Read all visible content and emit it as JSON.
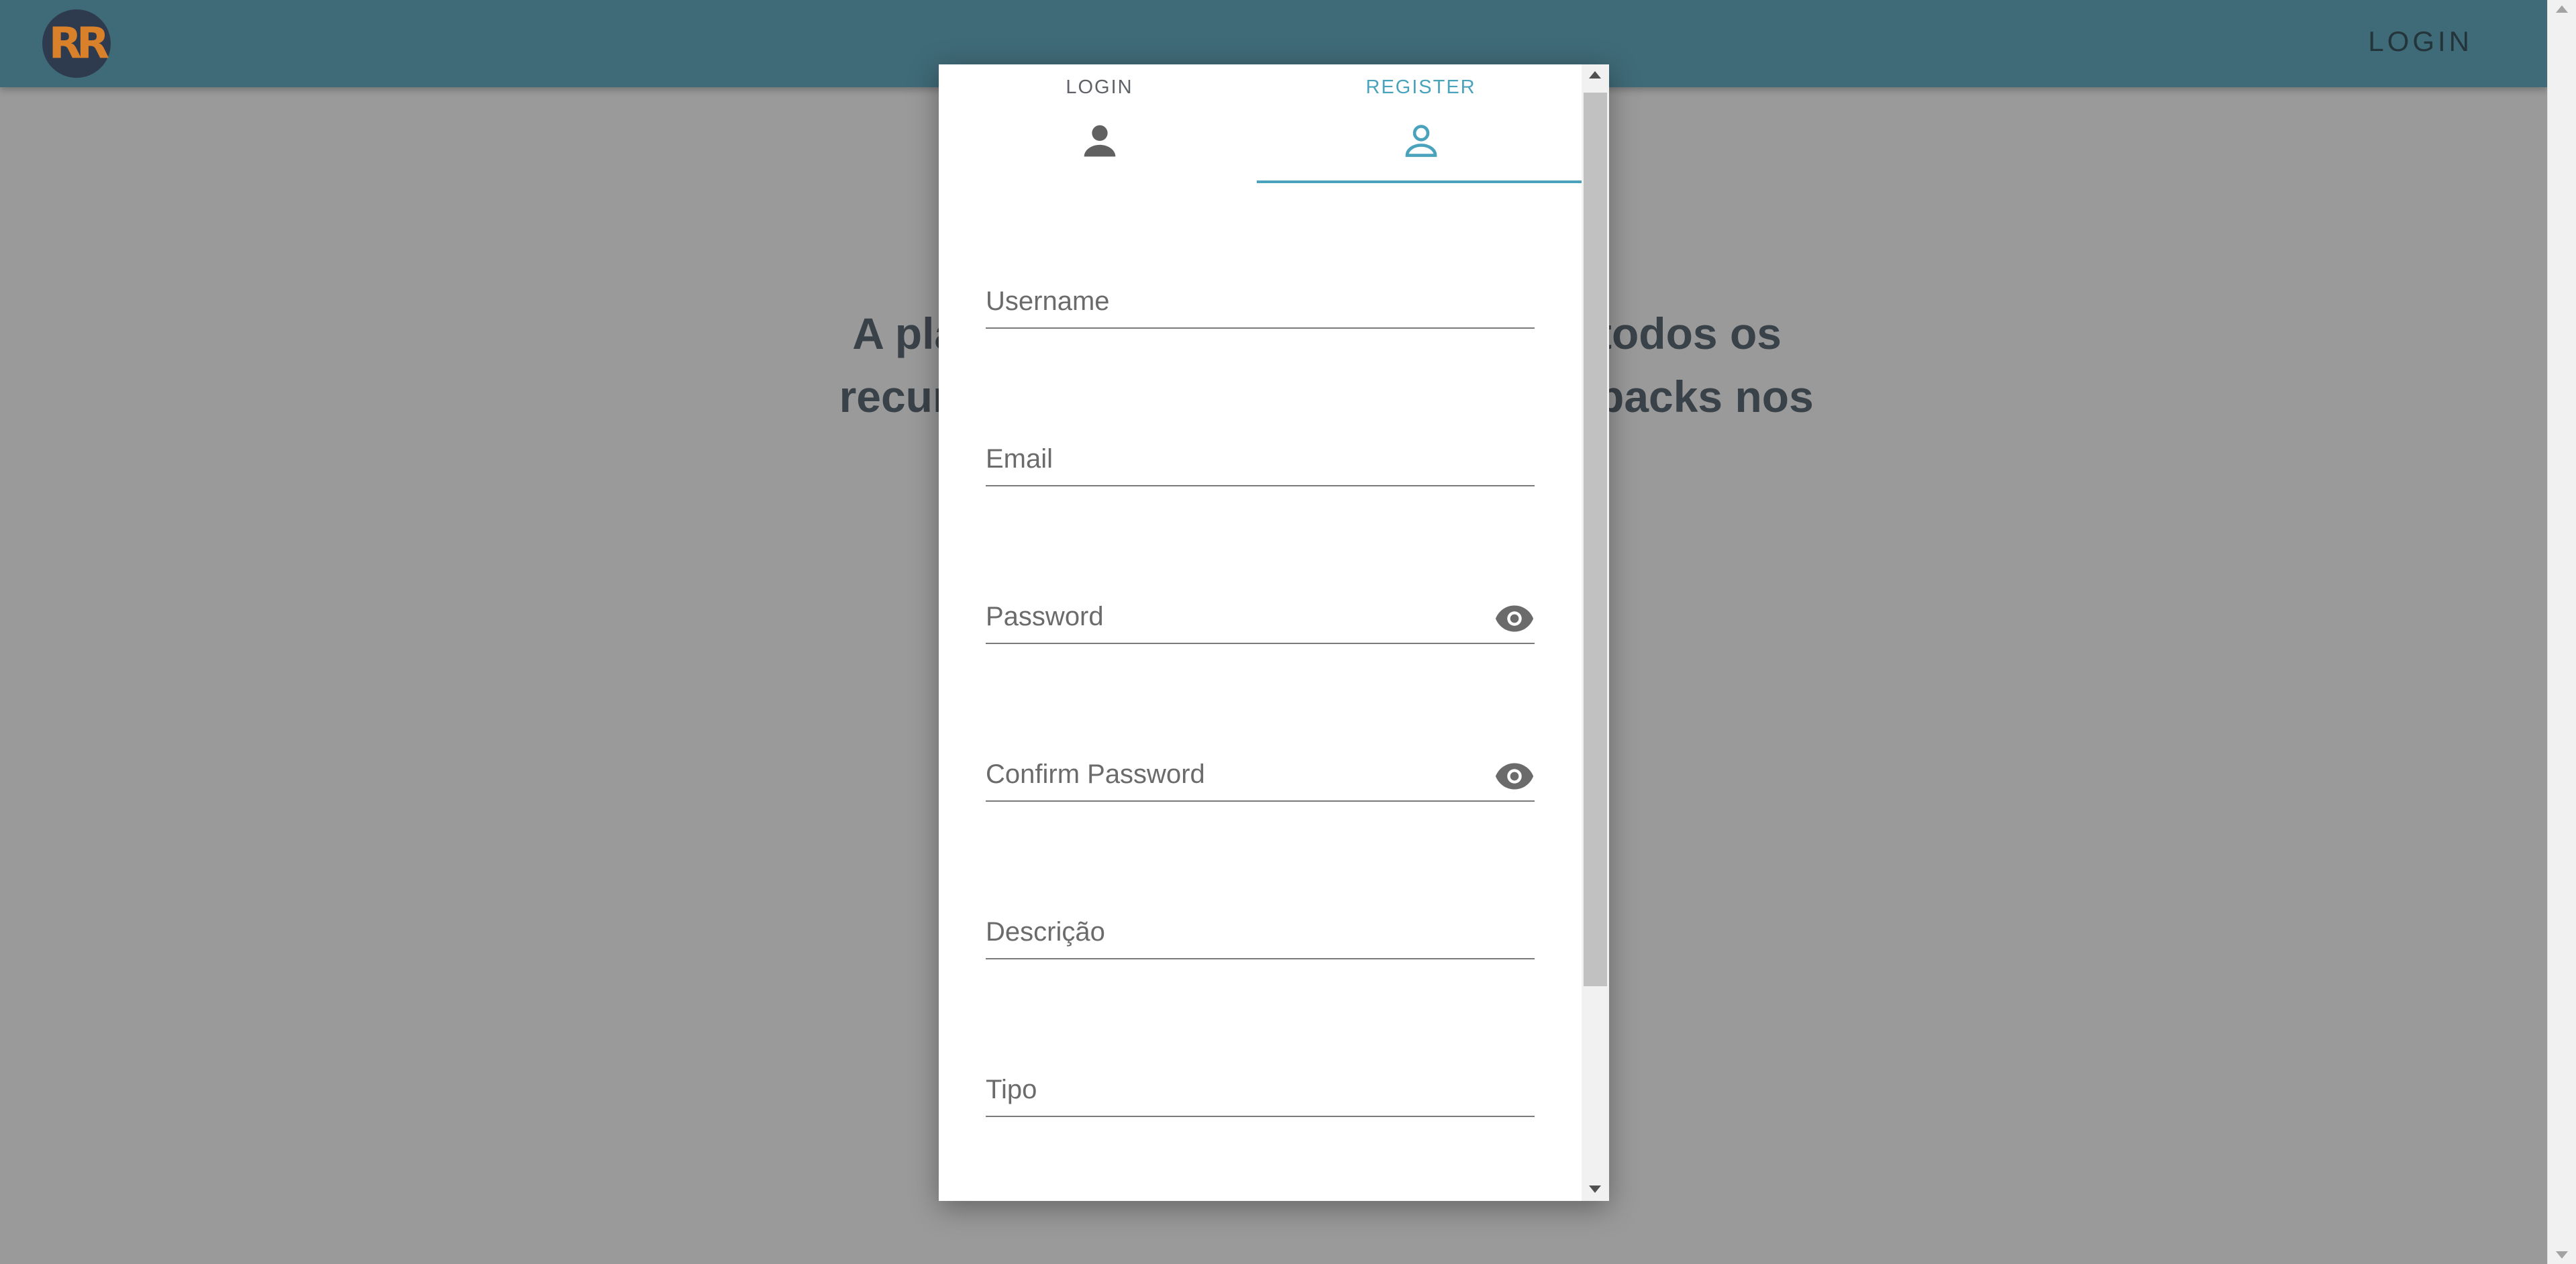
{
  "header": {
    "logo_text": "RR",
    "nav_login": "LOGIN"
  },
  "hero": {
    "line1_left": "A plafat",
    "line2_left": "recursos",
    "line1_right": "todos os",
    "line2_right": "backs nos"
  },
  "dialog": {
    "tabs": [
      {
        "label": "LOGIN",
        "icon": "person-filled-icon",
        "active": false
      },
      {
        "label": "REGISTER",
        "icon": "person-outline-icon",
        "active": true
      }
    ],
    "fields": {
      "username": "Username",
      "email": "Email",
      "password": "Password",
      "confirm_password": "Confirm Password",
      "descricao": "Descrição",
      "tipo": "Tipo"
    }
  },
  "colors": {
    "header_bg": "#3f6a77",
    "accent": "#4aa3bd",
    "overlay_bg": "#9a9a9a"
  }
}
